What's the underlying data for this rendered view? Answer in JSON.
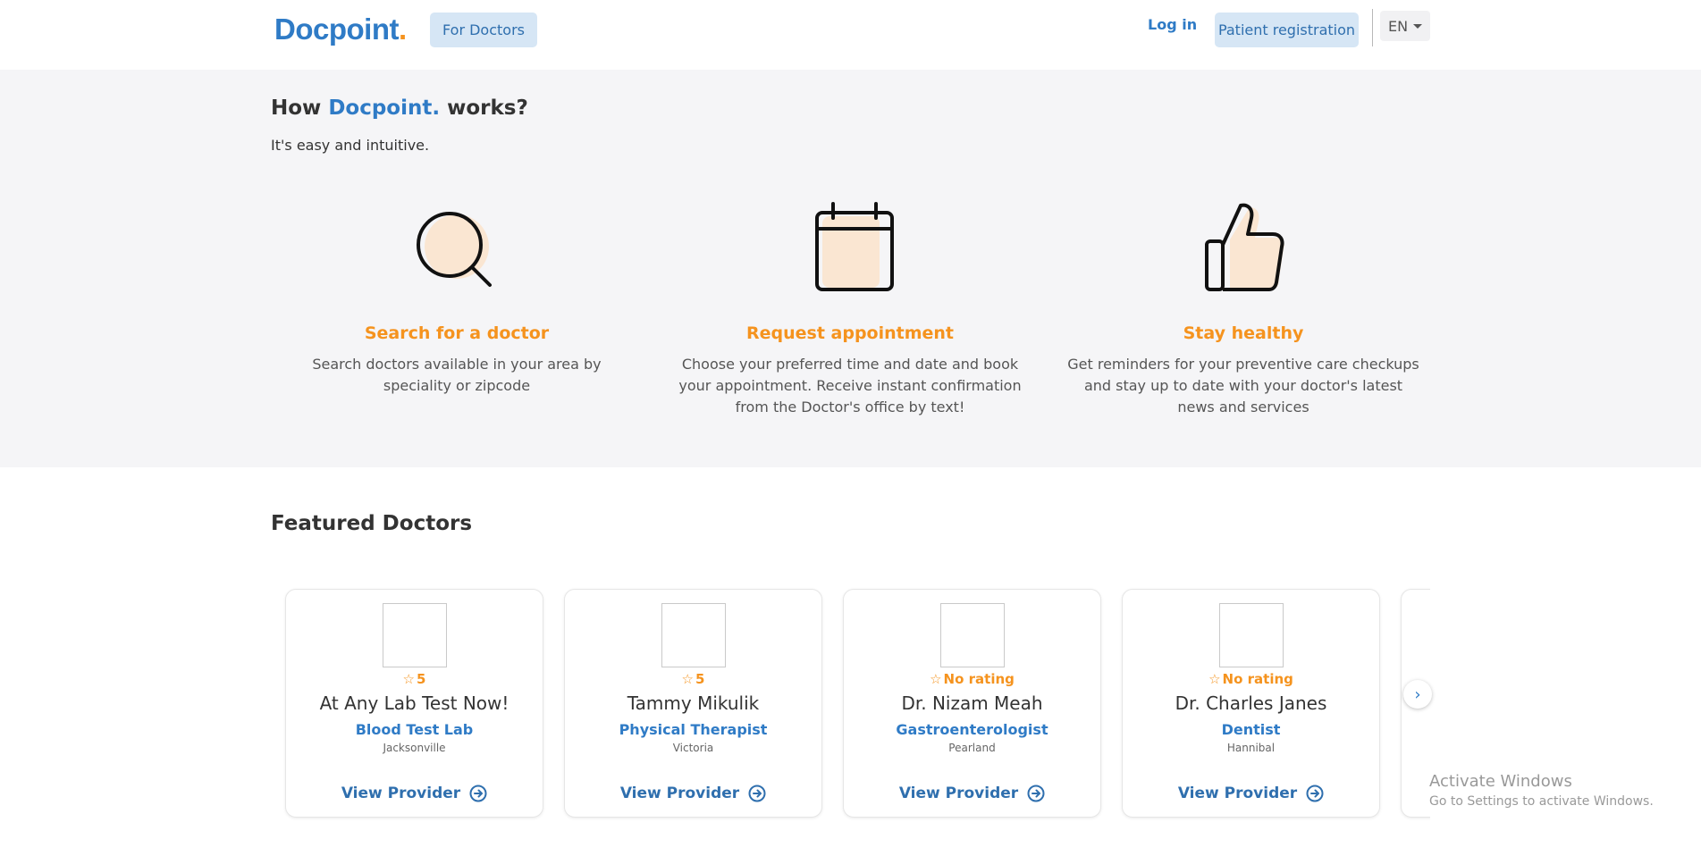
{
  "header": {
    "logo_text": "Docpoint",
    "logo_dot": ".",
    "for_doctors": "For Doctors",
    "login": "Log in",
    "patient_registration": "Patient registration",
    "language": "EN"
  },
  "how_it_works": {
    "title_prefix": "How ",
    "title_brand": "Docpoint.",
    "title_suffix": " works?",
    "subtitle": "It's easy and intuitive.",
    "steps": [
      {
        "icon": "search-icon",
        "title": "Search for a doctor",
        "description": "Search doctors available in your area by speciality or zipcode"
      },
      {
        "icon": "calendar-icon",
        "title": "Request appointment",
        "description": "Choose your preferred time and date and book your appointment. Receive instant confirmation from the Doctor's office by text!"
      },
      {
        "icon": "thumbs-up-icon",
        "title": "Stay healthy",
        "description": "Get reminders for your preventive care checkups and stay up to date with your doctor's latest news and services"
      }
    ]
  },
  "featured": {
    "title": "Featured Doctors",
    "view_label": "View Provider",
    "doctors": [
      {
        "rating": "5",
        "name": "At Any Lab Test Now!",
        "specialty": "Blood Test Lab",
        "city": "Jacksonville"
      },
      {
        "rating": "5",
        "name": "Tammy Mikulik",
        "specialty": "Physical Therapist",
        "city": "Victoria"
      },
      {
        "rating": "No rating",
        "name": "Dr. Nizam Meah",
        "specialty": "Gastroenterologist",
        "city": "Pearland"
      },
      {
        "rating": "No rating",
        "name": "Dr. Charles Janes",
        "specialty": "Dentist",
        "city": "Hannibal"
      }
    ]
  },
  "colors": {
    "brand_blue": "#2f7bc6",
    "accent_orange": "#f5931e",
    "section_bg": "#f5f5f7"
  },
  "watermark": {
    "line1": "Activate Windows",
    "line2": "Go to Settings to activate Windows."
  }
}
